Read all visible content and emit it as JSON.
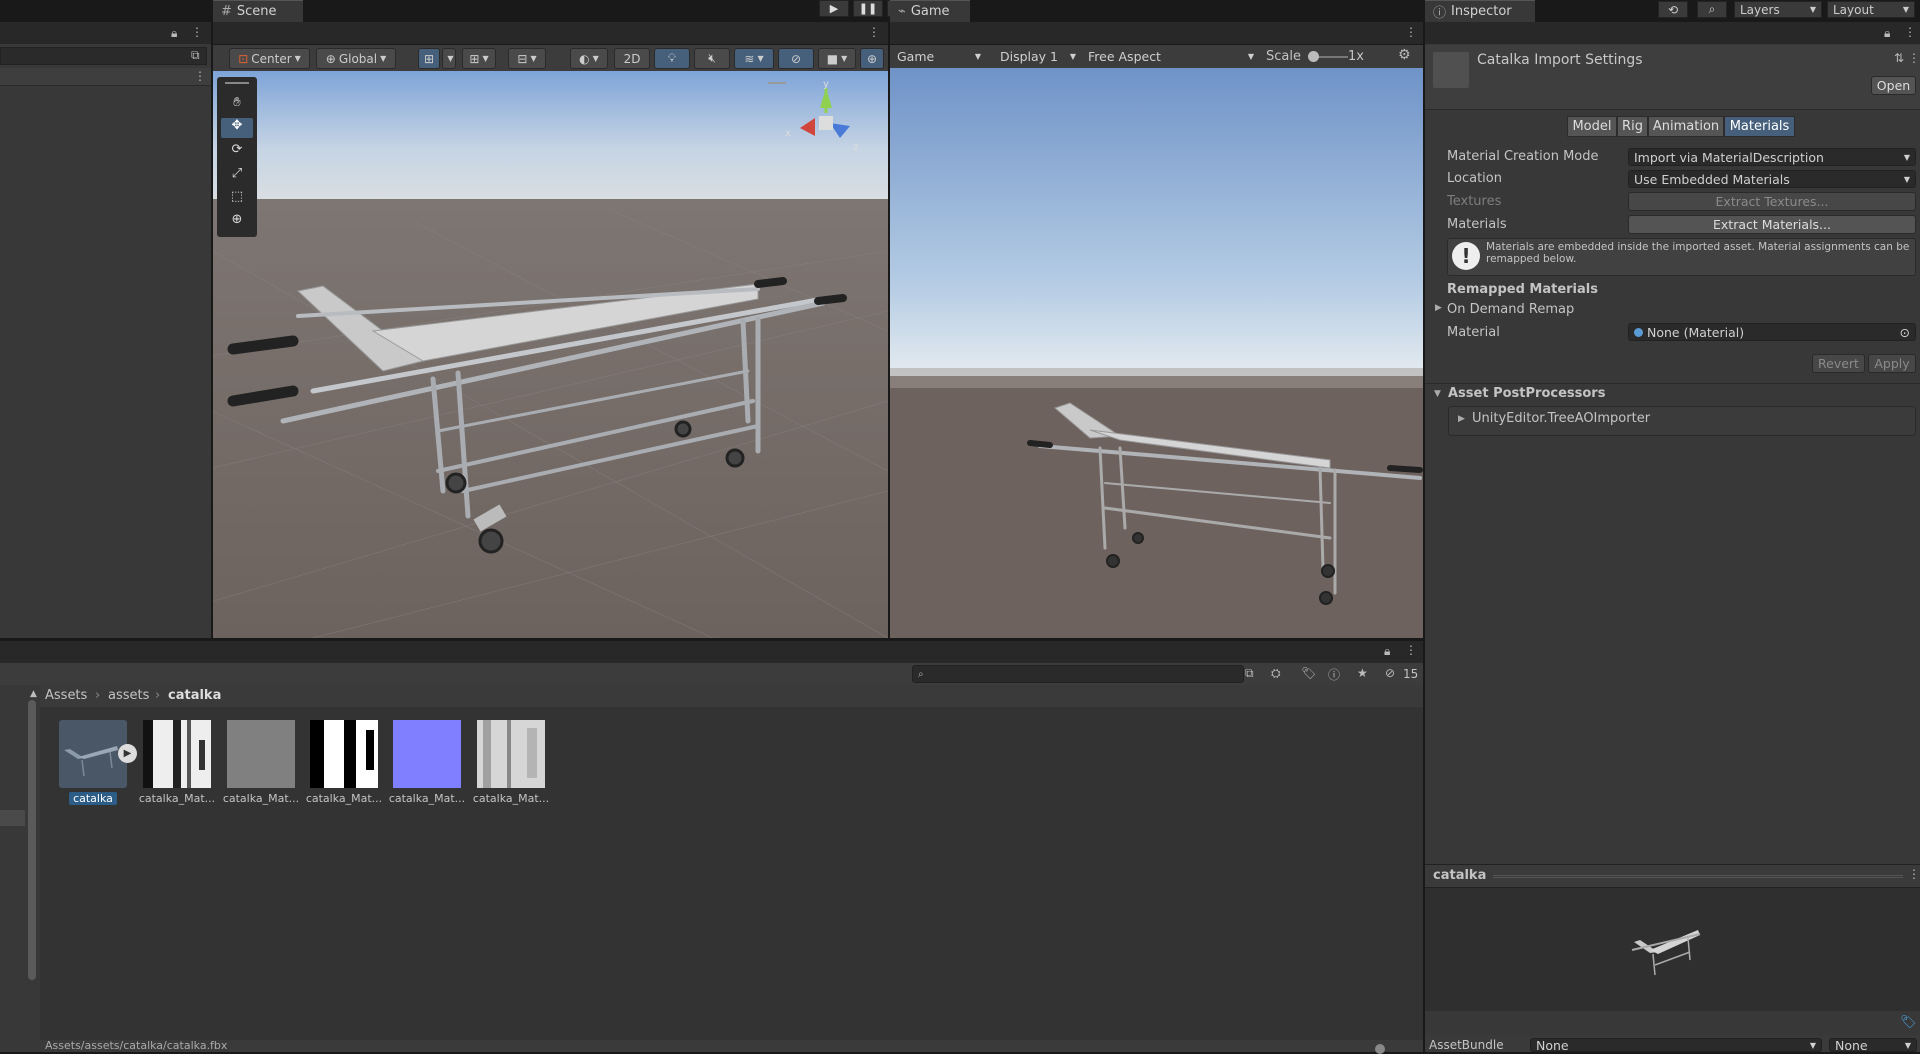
{
  "play": {
    "play_icon": "play-icon",
    "pause_icon": "pause-icon",
    "step_icon": "step-icon"
  },
  "topbar": {
    "layers": "Layers",
    "layout": "Layout"
  },
  "scene": {
    "tab": "Scene",
    "toolbar": {
      "pivot": "Center",
      "space": "Global",
      "mode_2d": "2D"
    },
    "tools": [
      "hand-tool",
      "move-tool",
      "rotate-tool",
      "scale-tool",
      "rect-tool",
      "transform-tool"
    ],
    "gizmo": {
      "y": "y",
      "x": "x",
      "z": "z"
    }
  },
  "game": {
    "tab": "Game",
    "view_select": "Game",
    "display": "Display 1",
    "aspect": "Free Aspect",
    "scale_label": "Scale",
    "scale_value": "1x"
  },
  "inspector": {
    "tab": "Inspector",
    "title": "Catalka Import Settings",
    "open": "Open",
    "tabs": [
      {
        "label": "Model",
        "active": false
      },
      {
        "label": "Rig",
        "active": false
      },
      {
        "label": "Animation",
        "active": false
      },
      {
        "label": "Materials",
        "active": true
      }
    ],
    "material_creation_mode": {
      "label": "Material Creation Mode",
      "value": "Import via MaterialDescription"
    },
    "location": {
      "label": "Location",
      "value": "Use Embedded Materials"
    },
    "textures": {
      "label": "Textures",
      "button": "Extract Textures..."
    },
    "materials": {
      "label": "Materials",
      "button": "Extract Materials..."
    },
    "info": "Materials are embedded inside the imported asset. Material assignments can be remapped below.",
    "remapped_header": "Remapped Materials",
    "on_demand": "On Demand Remap",
    "material_slot": {
      "label": "Material",
      "value": "None (Material)"
    },
    "revert": "Revert",
    "apply": "Apply",
    "postprocessors_header": "Asset PostProcessors",
    "postprocessor_item": "UnityEditor.TreeAOImporter",
    "preview_title": "catalka",
    "assetbundle": {
      "label": "AssetBundle",
      "value": "None",
      "variant": "None"
    }
  },
  "project": {
    "search_placeholder": "",
    "hidden_count": "15",
    "breadcrumb": [
      "Assets",
      "assets",
      "catalka"
    ],
    "assets": [
      {
        "label": "catalka",
        "selected": true,
        "kind": "model"
      },
      {
        "label": "catalka_Mat...",
        "selected": false,
        "kind": "tex-stripes"
      },
      {
        "label": "catalka_Mat...",
        "selected": false,
        "kind": "tex-gray"
      },
      {
        "label": "catalka_Mat...",
        "selected": false,
        "kind": "tex-bw"
      },
      {
        "label": "catalka_Mat...",
        "selected": false,
        "kind": "tex-normal"
      },
      {
        "label": "catalka_Mat...",
        "selected": false,
        "kind": "tex-light"
      }
    ],
    "status_path": "Assets/assets/catalka/catalka.fbx"
  },
  "colors": {
    "accent": "#46607c",
    "selected_label": "#2c5d87",
    "normal_map": "#7f7fff"
  }
}
